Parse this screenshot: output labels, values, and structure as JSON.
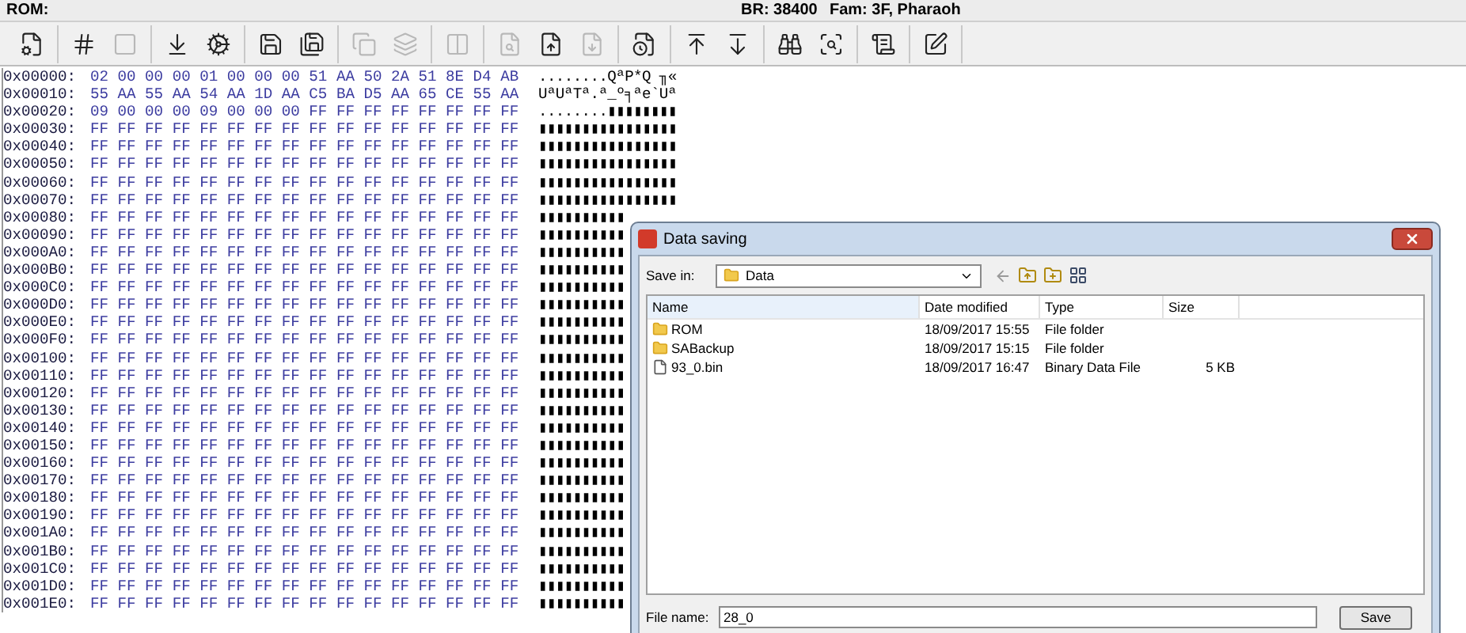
{
  "status": {
    "rom": "ROM:",
    "baud": "BR: 38400",
    "family": "Fam: 3F, Pharaoh"
  },
  "toolbar": [
    [
      {
        "disabled": false
      }
    ],
    [
      {
        "disabled": false
      },
      {
        "disabled": true
      }
    ],
    [
      {
        "disabled": false
      },
      {
        "disabled": false
      }
    ],
    [
      {
        "disabled": false
      },
      {
        "disabled": false
      }
    ],
    [
      {
        "disabled": true
      },
      {
        "disabled": true
      }
    ],
    [
      {
        "disabled": true
      }
    ],
    [
      {
        "disabled": true
      },
      {
        "disabled": false
      },
      {
        "disabled": true
      }
    ],
    [
      {
        "disabled": false
      }
    ],
    [
      {
        "disabled": false
      },
      {
        "disabled": false
      }
    ],
    [
      {
        "disabled": false
      },
      {
        "disabled": false
      }
    ],
    [
      {
        "disabled": false
      }
    ],
    [
      {
        "disabled": false
      }
    ]
  ],
  "hex_rows": [
    {
      "offset": "0x00000:",
      "bytes": "02 00 00 00 01 00 00 00 51 AA 50 2A 51 8E D4 AB",
      "ascii": "........QªP*Q ╖«"
    },
    {
      "offset": "0x00010:",
      "bytes": "55 AA 55 AA 54 AA 1D AA C5 BA D5 AA 65 CE 55 AA",
      "ascii": "UªUªTª.ª_º╕ªe`Uª"
    },
    {
      "offset": "0x00020:",
      "bytes": "09 00 00 00 09 00 00 00 FF FF FF FF FF FF FF FF",
      "ascii": "........▮▮▮▮▮▮▮▮"
    },
    {
      "offset": "0x00030:",
      "bytes": "FF FF FF FF FF FF FF FF FF FF FF FF FF FF FF FF",
      "ascii": "▮▮▮▮▮▮▮▮▮▮▮▮▮▮▮▮"
    },
    {
      "offset": "0x00040:",
      "bytes": "FF FF FF FF FF FF FF FF FF FF FF FF FF FF FF FF",
      "ascii": "▮▮▮▮▮▮▮▮▮▮▮▮▮▮▮▮"
    },
    {
      "offset": "0x00050:",
      "bytes": "FF FF FF FF FF FF FF FF FF FF FF FF FF FF FF FF",
      "ascii": "▮▮▮▮▮▮▮▮▮▮▮▮▮▮▮▮"
    },
    {
      "offset": "0x00060:",
      "bytes": "FF FF FF FF FF FF FF FF FF FF FF FF FF FF FF FF",
      "ascii": "▮▮▮▮▮▮▮▮▮▮▮▮▮▮▮▮"
    },
    {
      "offset": "0x00070:",
      "bytes": "FF FF FF FF FF FF FF FF FF FF FF FF FF FF FF FF",
      "ascii": "▮▮▮▮▮▮▮▮▮▮▮▮▮▮▮▮"
    },
    {
      "offset": "0x00080:",
      "bytes": "FF FF FF FF FF FF FF FF FF FF FF FF FF FF FF FF",
      "ascii": "▮▮▮▮▮▮▮▮▮▮"
    },
    {
      "offset": "0x00090:",
      "bytes": "FF FF FF FF FF FF FF FF FF FF FF FF FF FF FF FF",
      "ascii": "▮▮▮▮▮▮▮▮▮▮"
    },
    {
      "offset": "0x000A0:",
      "bytes": "FF FF FF FF FF FF FF FF FF FF FF FF FF FF FF FF",
      "ascii": "▮▮▮▮▮▮▮▮▮▮"
    },
    {
      "offset": "0x000B0:",
      "bytes": "FF FF FF FF FF FF FF FF FF FF FF FF FF FF FF FF",
      "ascii": "▮▮▮▮▮▮▮▮▮▮"
    },
    {
      "offset": "0x000C0:",
      "bytes": "FF FF FF FF FF FF FF FF FF FF FF FF FF FF FF FF",
      "ascii": "▮▮▮▮▮▮▮▮▮▮"
    },
    {
      "offset": "0x000D0:",
      "bytes": "FF FF FF FF FF FF FF FF FF FF FF FF FF FF FF FF",
      "ascii": "▮▮▮▮▮▮▮▮▮▮"
    },
    {
      "offset": "0x000E0:",
      "bytes": "FF FF FF FF FF FF FF FF FF FF FF FF FF FF FF FF",
      "ascii": "▮▮▮▮▮▮▮▮▮▮"
    },
    {
      "offset": "0x000F0:",
      "bytes": "FF FF FF FF FF FF FF FF FF FF FF FF FF FF FF FF",
      "ascii": "▮▮▮▮▮▮▮▮▮▮"
    },
    {
      "offset": "0x00100:",
      "bytes": "FF FF FF FF FF FF FF FF FF FF FF FF FF FF FF FF",
      "ascii": "▮▮▮▮▮▮▮▮▮▮"
    },
    {
      "offset": "0x00110:",
      "bytes": "FF FF FF FF FF FF FF FF FF FF FF FF FF FF FF FF",
      "ascii": "▮▮▮▮▮▮▮▮▮▮"
    },
    {
      "offset": "0x00120:",
      "bytes": "FF FF FF FF FF FF FF FF FF FF FF FF FF FF FF FF",
      "ascii": "▮▮▮▮▮▮▮▮▮▮"
    },
    {
      "offset": "0x00130:",
      "bytes": "FF FF FF FF FF FF FF FF FF FF FF FF FF FF FF FF",
      "ascii": "▮▮▮▮▮▮▮▮▮▮"
    },
    {
      "offset": "0x00140:",
      "bytes": "FF FF FF FF FF FF FF FF FF FF FF FF FF FF FF FF",
      "ascii": "▮▮▮▮▮▮▮▮▮▮"
    },
    {
      "offset": "0x00150:",
      "bytes": "FF FF FF FF FF FF FF FF FF FF FF FF FF FF FF FF",
      "ascii": "▮▮▮▮▮▮▮▮▮▮"
    },
    {
      "offset": "0x00160:",
      "bytes": "FF FF FF FF FF FF FF FF FF FF FF FF FF FF FF FF",
      "ascii": "▮▮▮▮▮▮▮▮▮▮"
    },
    {
      "offset": "0x00170:",
      "bytes": "FF FF FF FF FF FF FF FF FF FF FF FF FF FF FF FF",
      "ascii": "▮▮▮▮▮▮▮▮▮▮"
    },
    {
      "offset": "0x00180:",
      "bytes": "FF FF FF FF FF FF FF FF FF FF FF FF FF FF FF FF",
      "ascii": "▮▮▮▮▮▮▮▮▮▮"
    },
    {
      "offset": "0x00190:",
      "bytes": "FF FF FF FF FF FF FF FF FF FF FF FF FF FF FF FF",
      "ascii": "▮▮▮▮▮▮▮▮▮▮"
    },
    {
      "offset": "0x001A0:",
      "bytes": "FF FF FF FF FF FF FF FF FF FF FF FF FF FF FF FF",
      "ascii": "▮▮▮▮▮▮▮▮▮▮"
    },
    {
      "offset": "0x001B0:",
      "bytes": "FF FF FF FF FF FF FF FF FF FF FF FF FF FF FF FF",
      "ascii": "▮▮▮▮▮▮▮▮▮▮"
    },
    {
      "offset": "0x001C0:",
      "bytes": "FF FF FF FF FF FF FF FF FF FF FF FF FF FF FF FF",
      "ascii": "▮▮▮▮▮▮▮▮▮▮"
    },
    {
      "offset": "0x001D0:",
      "bytes": "FF FF FF FF FF FF FF FF FF FF FF FF FF FF FF FF",
      "ascii": "▮▮▮▮▮▮▮▮▮▮"
    },
    {
      "offset": "0x001E0:",
      "bytes": "FF FF FF FF FF FF FF FF FF FF FF FF FF FF FF FF",
      "ascii": "▮▮▮▮▮▮▮▮▮▮"
    }
  ],
  "dialog": {
    "title": "Data saving",
    "save_in_label": "Save in:",
    "save_in_value": "Data",
    "columns": [
      "Name",
      "Date modified",
      "Type",
      "Size"
    ],
    "files": [
      {
        "kind": "folder",
        "name": "ROM",
        "date": "18/09/2017 15:55",
        "type": "File folder"
      },
      {
        "kind": "folder",
        "name": "SABackup",
        "date": "18/09/2017 15:15",
        "type": "File folder"
      },
      {
        "kind": "binary",
        "name": "93_0.bin",
        "date": "18/09/2017 16:47",
        "type": "Binary Data File",
        "size": "5 KB"
      }
    ],
    "file_name_label": "File name:",
    "file_name_value": "28_0",
    "save_button": "Save"
  }
}
